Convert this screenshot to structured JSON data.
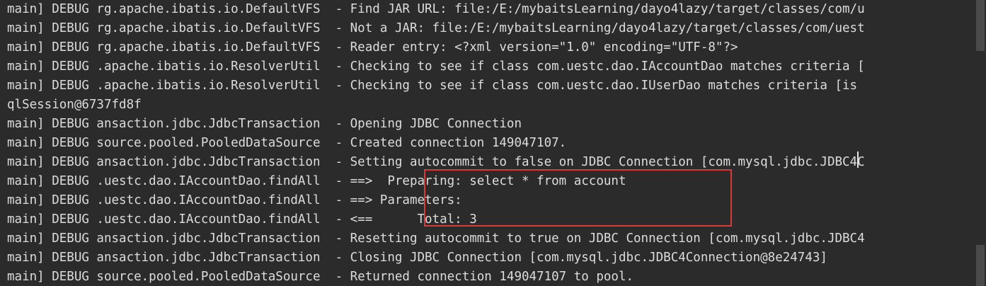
{
  "console": {
    "lines": [
      "main] DEBUG rg.apache.ibatis.io.DefaultVFS  - Find JAR URL: file:/E:/mybaitsLearning/dayo4lazy/target/classes/com/u",
      "main] DEBUG rg.apache.ibatis.io.DefaultVFS  - Not a JAR: file:/E:/mybaitsLearning/dayo4lazy/target/classes/com/uest",
      "main] DEBUG rg.apache.ibatis.io.DefaultVFS  - Reader entry: <?xml version=\"1.0\" encoding=\"UTF-8\"?>",
      "main] DEBUG .apache.ibatis.io.ResolverUtil  - Checking to see if class com.uestc.dao.IAccountDao matches criteria [",
      "main] DEBUG .apache.ibatis.io.ResolverUtil  - Checking to see if class com.uestc.dao.IUserDao matches criteria [is",
      "qlSession@6737fd8f",
      "main] DEBUG ansaction.jdbc.JdbcTransaction  - Opening JDBC Connection",
      "main] DEBUG source.pooled.PooledDataSource  - Created connection 149047107.",
      "main] DEBUG ansaction.jdbc.JdbcTransaction  - Setting autocommit to false on JDBC Connection [com.mysql.jdbc.JDBC4C",
      "main] DEBUG .uestc.dao.IAccountDao.findAll  - ==>  Preparing: select * from account",
      "main] DEBUG .uestc.dao.IAccountDao.findAll  - ==> Parameters:",
      "main] DEBUG .uestc.dao.IAccountDao.findAll  - <==      Total: 3",
      "main] DEBUG ansaction.jdbc.JdbcTransaction  - Resetting autocommit to true on JDBC Connection [com.mysql.jdbc.JDBC4",
      "main] DEBUG ansaction.jdbc.JdbcTransaction  - Closing JDBC Connection [com.mysql.jdbc.JDBC4Connection@8e24743]",
      "main] DEBUG source.pooled.PooledDataSource  - Returned connection 149047107 to pool."
    ]
  },
  "colors": {
    "background": "#2b2b2b",
    "text": "#dcdcdc",
    "highlight_border": "#d93b3b"
  }
}
